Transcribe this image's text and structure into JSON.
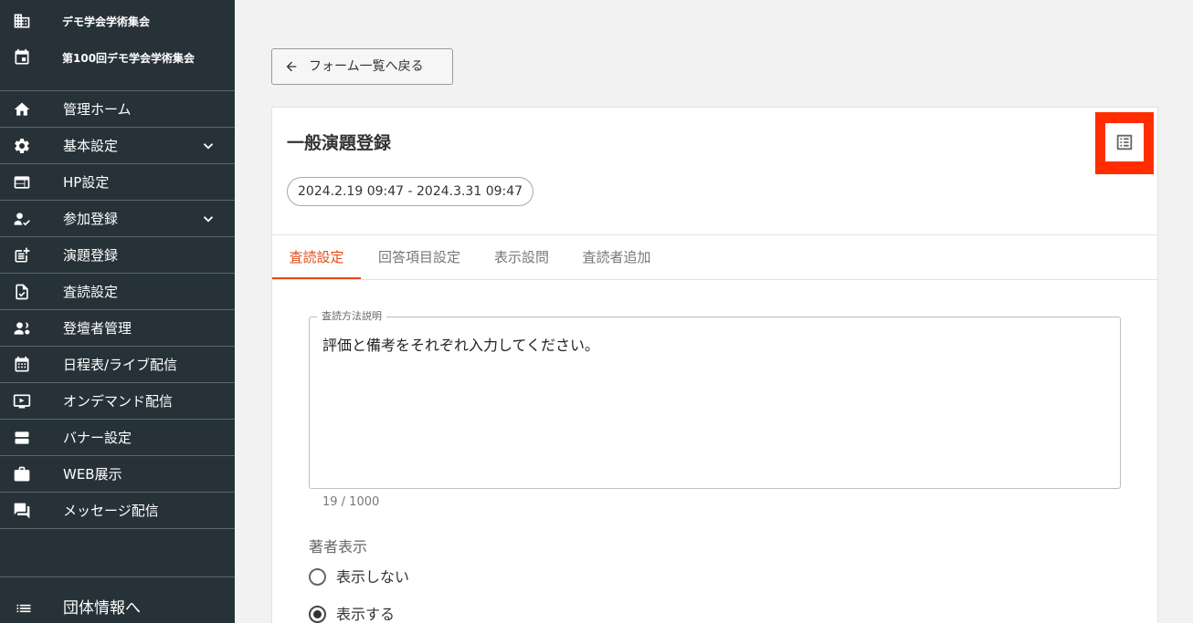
{
  "sidebar": {
    "organization": "デモ学会学術集会",
    "event": "第100回デモ学会学術集会",
    "items": [
      {
        "label": "管理ホーム"
      },
      {
        "label": "基本設定"
      },
      {
        "label": "HP設定"
      },
      {
        "label": "参加登録"
      },
      {
        "label": "演題登録"
      },
      {
        "label": "査読設定"
      },
      {
        "label": "登壇者管理"
      },
      {
        "label": "日程表/ライブ配信"
      },
      {
        "label": "オンデマンド配信"
      },
      {
        "label": "バナー設定"
      },
      {
        "label": "WEB展示"
      },
      {
        "label": "メッセージ配信"
      }
    ],
    "bottom_label": "団体情報へ"
  },
  "main": {
    "back_label": "フォーム一覧へ戻る",
    "form_title": "一般演題登録",
    "period": "2024.2.19 09:47 - 2024.3.31 09:47",
    "tabs": [
      {
        "label": "査読設定",
        "active": true
      },
      {
        "label": "回答項目設定",
        "active": false
      },
      {
        "label": "表示設問",
        "active": false
      },
      {
        "label": "査読者追加",
        "active": false
      }
    ],
    "description_field": {
      "label": "査読方法説明",
      "value": "評価と備考をそれぞれ入力してください。",
      "counter": "19 / 1000"
    },
    "author_display": {
      "label": "著者表示",
      "options": [
        {
          "label": "表示しない",
          "checked": false
        },
        {
          "label": "表示する",
          "checked": true
        }
      ]
    }
  },
  "colors": {
    "sidebar_bg": "#263238",
    "accent": "#e64a19",
    "highlight": "#ff2d00"
  }
}
